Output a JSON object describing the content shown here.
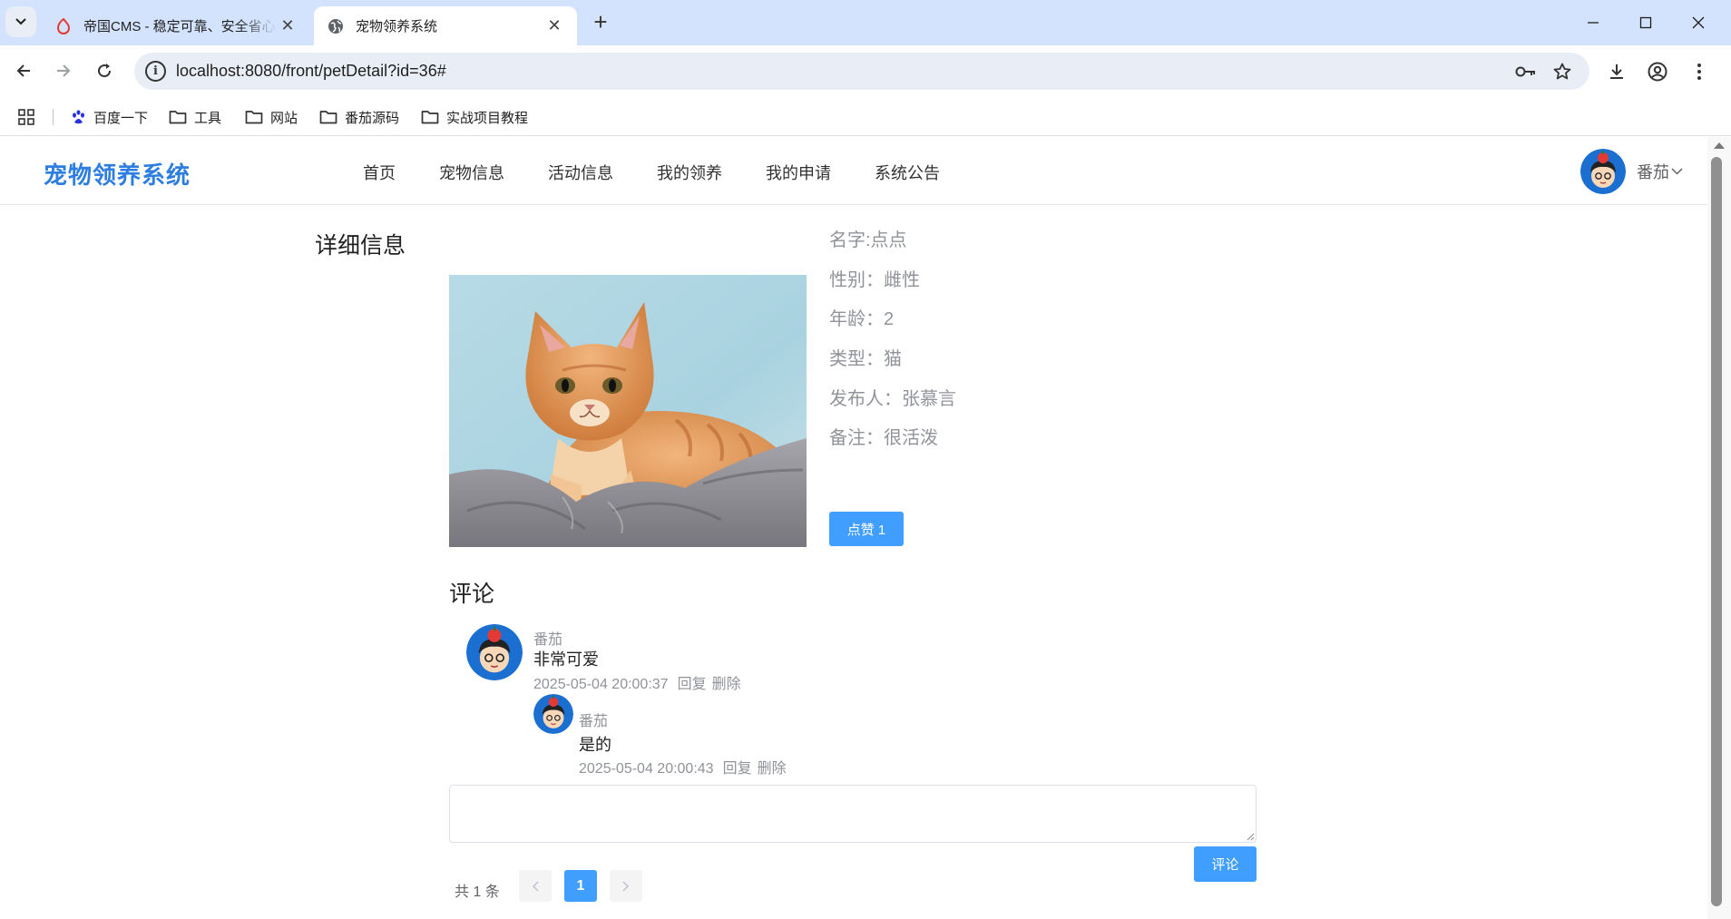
{
  "browser": {
    "tabs": [
      {
        "title": "帝国CMS - 稳定可靠、安全省心",
        "active": false,
        "icon": "empire-cms-favicon"
      },
      {
        "title": "宠物领养系统",
        "active": true,
        "icon": "globe-icon"
      }
    ],
    "url": "localhost:8080/front/petDetail?id=36#",
    "bookmarks": [
      "百度一下",
      "工具",
      "网站",
      "番茄源码",
      "实战项目教程"
    ]
  },
  "site": {
    "logo": "宠物领养系统",
    "menu": [
      "首页",
      "宠物信息",
      "活动信息",
      "我的领养",
      "我的申请",
      "系统公告"
    ],
    "user": "番茄"
  },
  "detail": {
    "section_title": "详细信息",
    "name": "名字:点点",
    "gender": "性别：雌性",
    "age": "年龄：2",
    "type": "类型：猫",
    "publisher": "发布人：张慕言",
    "note": "备注：很活泼",
    "like_label": "点赞 1"
  },
  "comments": {
    "title": "评论",
    "items": [
      {
        "user": "番茄",
        "content": "非常可爱",
        "time": "2025-05-04 20:00:37",
        "reply": "回复",
        "delete": "删除"
      },
      {
        "user": "番茄",
        "content": "是的",
        "time": "2025-05-04 20:00:43",
        "reply": "回复",
        "delete": "删除"
      }
    ],
    "input_value": "",
    "submit_label": "评论"
  },
  "pagination": {
    "total": "共 1 条",
    "current": "1"
  },
  "colors": {
    "primary": "#409eff",
    "logo": "#2d7ee0",
    "chrome_tabbar": "#d3e3fd"
  }
}
